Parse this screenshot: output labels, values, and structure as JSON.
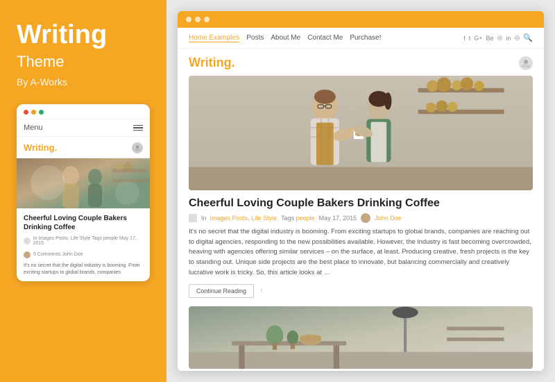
{
  "left": {
    "title": "Writing",
    "subtitle": "Theme",
    "by": "By A-Works",
    "mobile": {
      "menu_label": "Menu",
      "logo": "Writing",
      "logo_dot": ".",
      "post_title": "Cheerful Loving Couple Bakers Drinking Coffee",
      "post_meta": "In Images Posts, Life Style  Tags people  May 17, 2015",
      "post_meta_author": "5 Comments  John Doe",
      "post_excerpt": "It's no secret that the digital industry is booming. From exciting startups to global brands, companies"
    }
  },
  "browser": {
    "nav": {
      "links": [
        "Home Examples",
        "Posts",
        "About Me",
        "Contact Me",
        "Purchase!"
      ],
      "social_icons": [
        "f",
        "t",
        "G+",
        "Be",
        "●",
        "in",
        "●"
      ],
      "search_icon": "🔍"
    },
    "site_logo": "Writing",
    "site_logo_dot": ".",
    "featured_post": {
      "title": "Cheerful Loving Couple Bakers Drinking Coffee",
      "meta_category": "In  Images Posts, Life Style",
      "meta_tags": "Tags people",
      "meta_date": "May 17, 2015",
      "meta_comments": "5 Comments",
      "meta_author": "John Doe",
      "excerpt": "It's no secret that the digital industry is booming. From exciting startups to global brands, companies are reaching out to digital agencies, responding to the new possibilities available. However, the industry is fast becoming overcrowded, heaving with agencies offering similar services – on the surface, at least. Producing creative, fresh projects is the key to standing out. Unique side projects are the best place to innovate, but balancing commercially and creatively lucrative work is tricky. So, this article looks at …",
      "continue_btn": "Continue Reading",
      "share_icon": "↑"
    },
    "colors": {
      "accent": "#F5A623",
      "text_dark": "#222222",
      "text_mid": "#555555",
      "text_light": "#888888"
    }
  }
}
